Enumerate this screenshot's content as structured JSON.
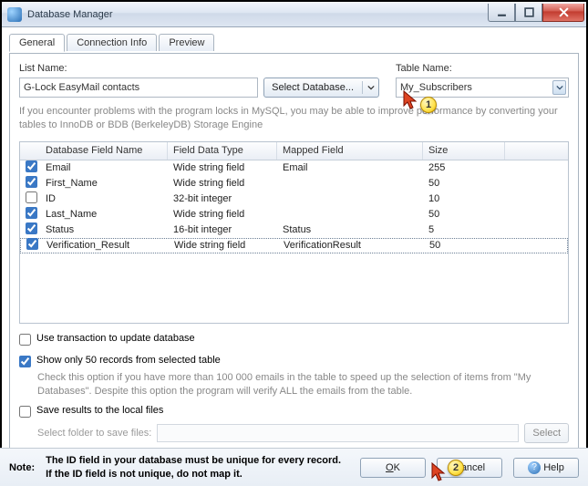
{
  "window": {
    "title": "Database Manager",
    "middle_title": ""
  },
  "tabs": [
    {
      "label": "General",
      "active": true
    },
    {
      "label": "Connection Info",
      "active": false
    },
    {
      "label": "Preview",
      "active": false
    }
  ],
  "list_name": {
    "label": "List Name:",
    "value": "G-Lock EasyMail contacts",
    "select_db_button": "Select Database..."
  },
  "table_name": {
    "label": "Table Name:",
    "value": "My_Subscribers"
  },
  "hint": "If you encounter problems with the program locks in MySQL, you may be able to improve performance by converting your tables to InnoDB or  BDB (BerkeleyDB) Storage Engine",
  "grid": {
    "headers": [
      "Database Field Name",
      "Field Data Type",
      "Mapped Field",
      "Size"
    ],
    "rows": [
      {
        "checked": true,
        "name": "Email",
        "type": "Wide string field",
        "mapped": "Email",
        "size": "255"
      },
      {
        "checked": true,
        "name": "First_Name",
        "type": "Wide string field",
        "mapped": "",
        "size": "50"
      },
      {
        "checked": false,
        "name": "ID",
        "type": "32-bit integer",
        "mapped": "",
        "size": "10"
      },
      {
        "checked": true,
        "name": "Last_Name",
        "type": "Wide string field",
        "mapped": "",
        "size": "50"
      },
      {
        "checked": true,
        "name": "Status",
        "type": "16-bit integer",
        "mapped": "Status",
        "size": "5"
      },
      {
        "checked": true,
        "name": "Verification_Result",
        "type": "Wide string field",
        "mapped": "VerificationResult",
        "size": "50",
        "selected": true
      }
    ]
  },
  "options": {
    "use_transaction": {
      "checked": false,
      "label": "Use transaction to update database"
    },
    "show_only_50": {
      "checked": true,
      "label": "Show only 50 records from selected table",
      "hint": "Check this option if you have more than 100 000 emails in the table to speed up the selection of items from \"My Databases\". Despite this option the program will verify ALL the emails from the table."
    },
    "save_results": {
      "checked": false,
      "label": "Save results to the local files"
    },
    "folder_label": "Select folder to save files:",
    "folder_value": "",
    "select_button": "Select"
  },
  "footer": {
    "note_label": "Note:",
    "note_text": "The ID field in your database must be unique for every record. If the ID field is not unique, do not map it.",
    "ok": "OK",
    "cancel": "Cancel",
    "help": "Help"
  },
  "annotations": {
    "callout1": "1",
    "callout2": "2"
  }
}
